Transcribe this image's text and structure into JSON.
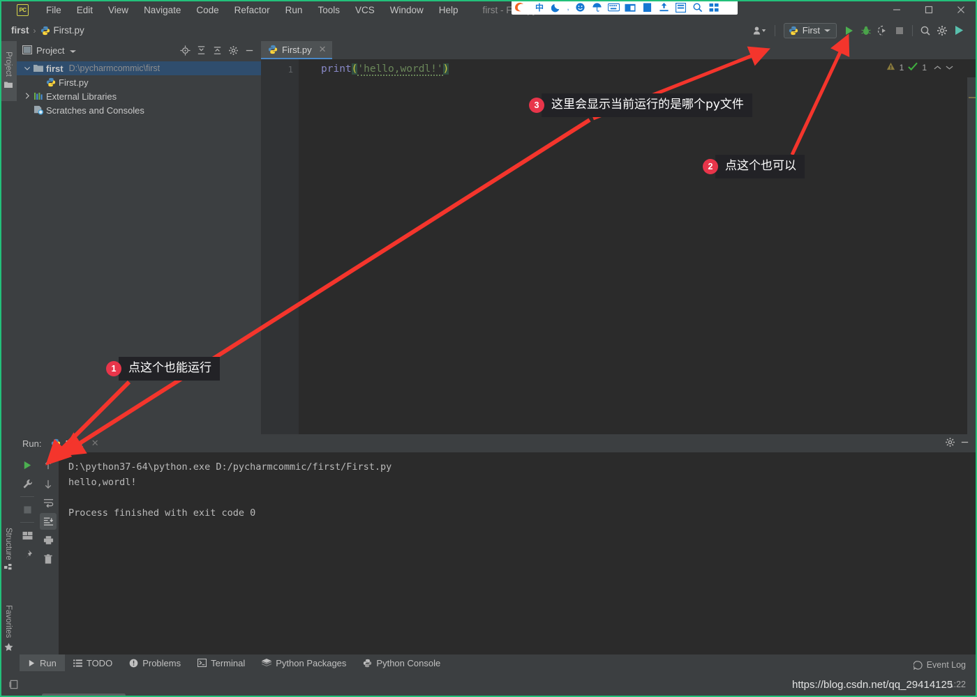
{
  "window": {
    "title": "first - First.py",
    "app_logo": "PC",
    "controls": {
      "minimize": "minimize-icon",
      "maximize": "maximize-icon",
      "close": "close-icon"
    }
  },
  "menu": [
    "File",
    "Edit",
    "View",
    "Navigate",
    "Code",
    "Refactor",
    "Run",
    "Tools",
    "VCS",
    "Window",
    "Help"
  ],
  "breadcrumb": {
    "project": "first",
    "separator": "›",
    "file": "First.py"
  },
  "toolbar": {
    "user_icon": "user-avatar-icon",
    "run_config": {
      "name": "First",
      "icon": "python-file-icon",
      "dropdown": "chevron-down-icon"
    },
    "run_button": "run-icon",
    "debug_button": "debug-bug-icon",
    "coverage_button": "run-with-coverage-icon",
    "stop_button": "stop-icon",
    "search_button": "search-icon",
    "settings_button": "gear-icon",
    "updates_button": "updates-icon"
  },
  "left_strip": {
    "top": [
      "Project"
    ],
    "bottom": [
      "Structure",
      "Favorites"
    ]
  },
  "project_panel": {
    "title": "Project",
    "dropdown": "chevron-down-icon",
    "actions": [
      "locate-icon",
      "expand-all-icon",
      "collapse-all-icon",
      "gear-icon",
      "hide-icon"
    ],
    "tree": [
      {
        "label": "first",
        "path": "D:\\pycharmcommic\\first",
        "icon": "folder-icon",
        "arrow": "chevron-down-icon",
        "depth": 0,
        "selected": true,
        "bold": true
      },
      {
        "label": "First.py",
        "path": "",
        "icon": "python-file-icon",
        "arrow": "",
        "depth": 1,
        "selected": false,
        "bold": false
      },
      {
        "label": "External Libraries",
        "path": "",
        "icon": "libraries-icon",
        "arrow": "chevron-right-icon",
        "depth": 0,
        "selected": false,
        "bold": false
      },
      {
        "label": "Scratches and Consoles",
        "path": "",
        "icon": "scratches-icon",
        "arrow": "",
        "depth": 0,
        "selected": false,
        "bold": false
      }
    ]
  },
  "editor": {
    "tab": {
      "label": "First.py",
      "icon": "python-file-icon",
      "close": "close-icon"
    },
    "line_number": "1",
    "code": {
      "fn": "print",
      "open_paren": "(",
      "string": "'hello,wordl!'",
      "close_paren": ")",
      "full": "print('hello,wordl!')"
    },
    "inspections": {
      "warning_icon": "warning-triangle-icon",
      "warning_count": "1",
      "ok_icon": "inspection-ok-icon",
      "ok_count": "1",
      "prev_icon": "chevron-up-icon",
      "next_icon": "chevron-down-icon"
    }
  },
  "run_panel": {
    "label": "Run:",
    "tab": {
      "label": "First",
      "icon": "python-file-icon",
      "close": "close-icon"
    },
    "header_actions": [
      "gear-icon",
      "hide-icon"
    ],
    "left_tools": [
      "run-icon",
      "wrench-icon",
      "stop-icon",
      "layout-icon",
      "pin-icon"
    ],
    "right_tools": [
      "arrow-up-icon",
      "arrow-down-icon",
      "soft-wrap-icon",
      "scroll-to-end-icon",
      "print-icon",
      "trash-icon"
    ],
    "console": [
      "D:\\python37-64\\python.exe D:/pycharmcommic/first/First.py",
      "hello,wordl!",
      "",
      "Process finished with exit code 0"
    ]
  },
  "bottom_tabs": [
    {
      "label": "Run",
      "icon": "run-icon",
      "selected": true
    },
    {
      "label": "TODO",
      "icon": "todo-icon",
      "selected": false
    },
    {
      "label": "Problems",
      "icon": "problems-icon",
      "selected": false
    },
    {
      "label": "Terminal",
      "icon": "terminal-icon",
      "selected": false
    },
    {
      "label": "Python Packages",
      "icon": "packages-icon",
      "selected": false
    },
    {
      "label": "Python Console",
      "icon": "python-console-icon",
      "selected": false
    }
  ],
  "status_bar": {
    "caret_position": "1:22",
    "event_log": {
      "label": "Event Log",
      "icon": "event-log-icon"
    },
    "left_icon": "layout-toggle-icon"
  },
  "watermark": "https://blog.csdn.net/qq_29414125",
  "callouts": [
    {
      "number": "1",
      "text": "点这个也能运行"
    },
    {
      "number": "2",
      "text": "点这个也可以"
    },
    {
      "number": "3",
      "text": "这里会显示当前运行的是哪个py文件"
    }
  ],
  "ime": {
    "icons": [
      "sogou-logo-icon",
      "chinese-mode-icon",
      "moon-icon",
      "comma-icon",
      "emoji-icon",
      "umbrella-icon",
      "keyboard-icon",
      "calendar-icon",
      "clipboard-icon",
      "upload-icon",
      "panel-icon",
      "search-icon",
      "apps-icon"
    ]
  },
  "colors": {
    "accent": "#4a88c7",
    "callout_red": "#e8354a",
    "arrow_red": "#f4352c",
    "border_green": "#22c07a",
    "run_green": "#4caf50"
  }
}
